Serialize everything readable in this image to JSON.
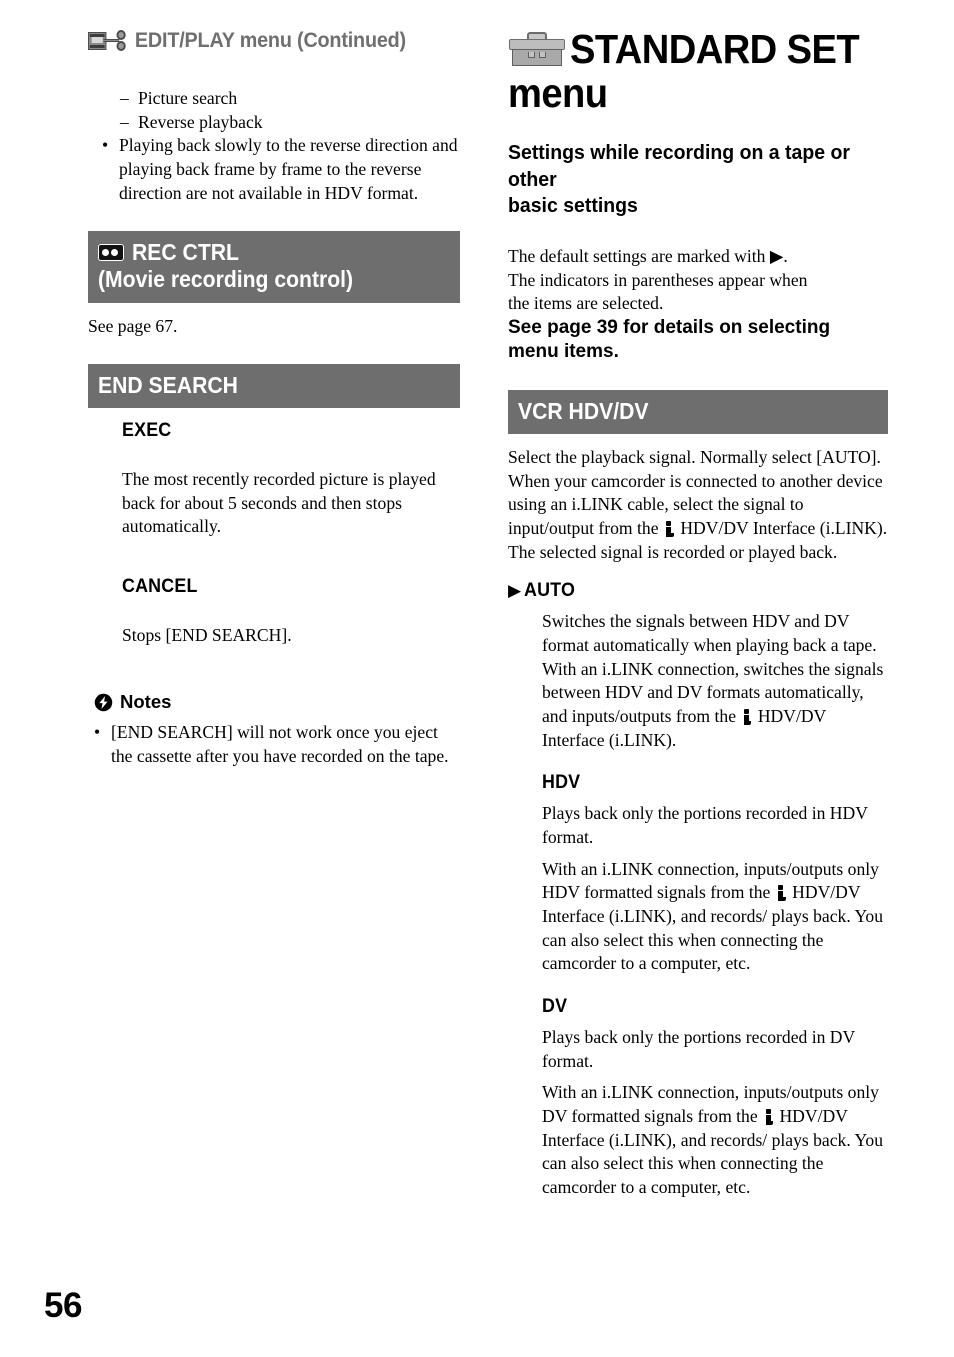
{
  "page": {
    "number": "56",
    "accent_gray": "#6e6e6e"
  },
  "left_column": {
    "running_head": {
      "icon": "film-scissors-edit-icon",
      "label": "EDIT/PLAY menu (Continued)"
    },
    "continued_list": {
      "dash_items": [
        "Picture search",
        "Reverse playback"
      ],
      "dash_mark": "–",
      "bullet_mark": "•",
      "bullet_items": [
        "Playing back slowly to the reverse direction and playing back frame by frame to the reverse direction are not available in HDV format."
      ]
    },
    "rec_ctrl": {
      "icon": "cassette-tape-icon",
      "title_line1": "REC CTRL",
      "title_line2": "(Movie recording control)",
      "body": "See page 67."
    },
    "end_search": {
      "title": "END SEARCH",
      "items": [
        {
          "label": "EXEC",
          "text": "The most recently recorded picture is played back for about 5 seconds and then stops automatically."
        },
        {
          "label": "CANCEL",
          "text": "Stops [END SEARCH]."
        }
      ]
    },
    "notes": {
      "icon": "lightning-bolt-note-icon",
      "heading": "Notes",
      "bullet_mark": "•",
      "items": [
        "[END SEARCH] will not work once you eject the cassette after you have recorded on the tape."
      ]
    }
  },
  "right_column": {
    "chapter": {
      "icon": "toolbox-icon",
      "title_line1": "STANDARD SET",
      "title_line2": "menu"
    },
    "subhead": {
      "line1": "Settings while recording on a tape or other",
      "line2": "basic settings"
    },
    "intro": {
      "line1": "The default settings are marked with ▶.",
      "line2": "The indicators in parentheses appear when",
      "line3": "the items are selected.",
      "see_page_line1": "See page 39 for details on selecting",
      "see_page_line2": "menu items."
    },
    "vcr_hdv_dv": {
      "title": "VCR HDV/DV",
      "intro": {
        "p1_a": "Select the playback signal. Normally select [AUTO].",
        "p2_a": "When your camcorder is connected to another device using an i.LINK cable, select the signal to input/output from the",
        "p2_icon": "ilink-icon",
        "p2_b": "HDV/DV Interface (i.LINK). The selected signal is recorded or played back."
      },
      "options": [
        {
          "marker": "▶",
          "label": "AUTO",
          "paragraphs": [
            {
              "a": "Switches the signals between HDV and DV format automatically when playing back a tape.",
              "icon": null,
              "b": null
            },
            {
              "a": "With an i.LINK connection, switches the signals between HDV and DV formats automatically, and inputs/outputs from the",
              "icon": "ilink-icon",
              "b": "HDV/DV Interface (i.LINK)."
            }
          ]
        },
        {
          "marker": "",
          "label": "HDV",
          "paragraphs": [
            {
              "a": "Plays back only the portions recorded in HDV format.",
              "icon": null,
              "b": null
            },
            {
              "a": "With an i.LINK connection, inputs/outputs only HDV formatted signals from the",
              "icon": "ilink-icon",
              "b": "HDV/DV Interface (i.LINK), and records/ plays back. You can also select this when connecting the camcorder to a computer, etc."
            }
          ]
        },
        {
          "marker": "",
          "label": "DV",
          "paragraphs": [
            {
              "a": "Plays back only the portions recorded in DV format.",
              "icon": null,
              "b": null
            },
            {
              "a": "With an i.LINK connection, inputs/outputs only DV formatted signals from the",
              "icon": "ilink-icon",
              "b": "HDV/DV Interface (i.LINK), and records/ plays back. You can also select this when connecting the camcorder to a computer, etc."
            }
          ]
        }
      ]
    }
  }
}
